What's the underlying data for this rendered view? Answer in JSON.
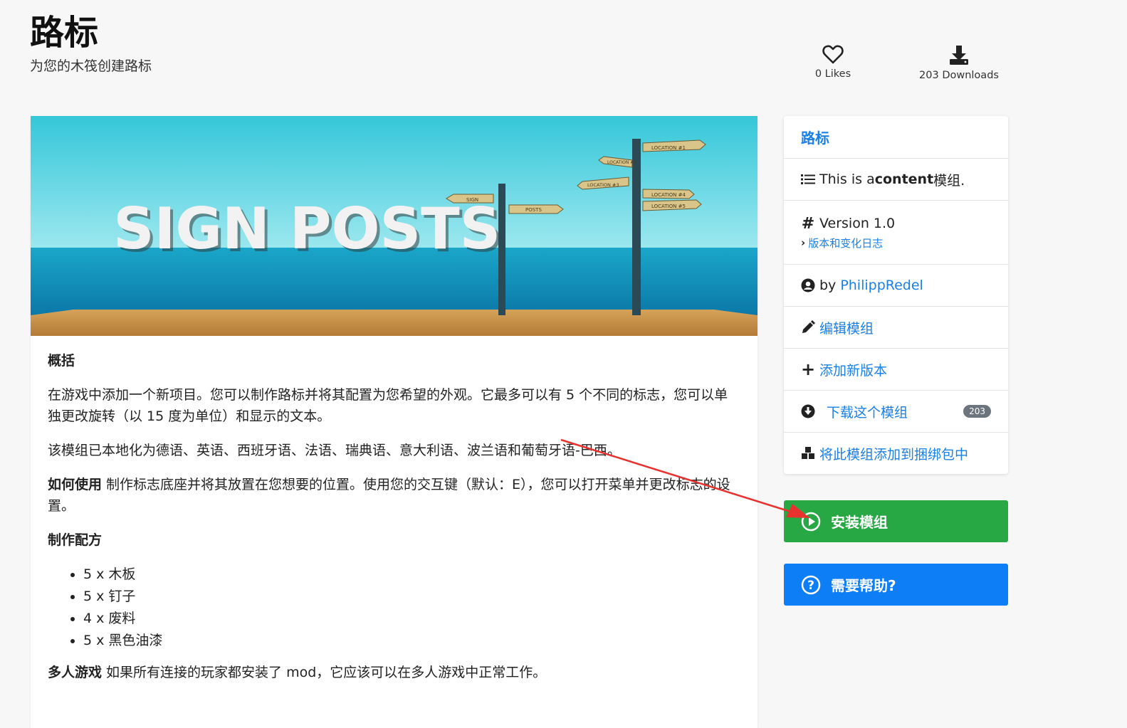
{
  "header": {
    "title": "路标",
    "subtitle": "为您的木筏创建路标",
    "likes": "0 Likes",
    "downloads": "203 Downloads"
  },
  "banner": {
    "title_text": "SIGN POSTS",
    "sign_labels": [
      "SIGN",
      "POSTS",
      "LOCATION #1",
      "LOCATION #2",
      "LOCATION #3",
      "LOCATION #4",
      "LOCATION #5"
    ]
  },
  "content": {
    "overview_heading": "概括",
    "overview_text": "在游戏中添加一个新项目。您可以制作路标并将其配置为您希望的外观。它最多可以有 5 个不同的标志，您可以单独更改旋转（以 15 度为单位）和显示的文本。",
    "localized_text": "该模组已本地化为德语、英语、西班牙语、法语、瑞典语、意大利语、波兰语和葡萄牙语-巴西。",
    "howto_label": "如何使用",
    "howto_text": " 制作标志底座并将其放置在您想要的位置。使用您的交互键（默认：E），您可以打开菜单并更改标志的设置。",
    "recipe_heading": "制作配方",
    "recipe_items": [
      "5 x 木板",
      "5 x 钉子",
      "4 x 废料",
      "5 x 黑色油漆"
    ],
    "multiplayer_label": "多人游戏",
    "multiplayer_text": " 如果所有连接的玩家都安装了 mod，它应该可以在多人游戏中正常工作。"
  },
  "sidebar": {
    "title": "路标",
    "type_prefix": "This is a ",
    "type_bold": "content",
    "type_suffix": " 模组.",
    "version": "Version 1.0",
    "changelog": "版本和变化日志",
    "by_prefix": "by ",
    "author": "PhilippRedel",
    "edit": "编辑模组",
    "add_version": "添加新版本",
    "download": "下载这个模组",
    "download_count": "203",
    "bundle": "将此模组添加到捆绑包中"
  },
  "buttons": {
    "install": "安装模组",
    "help": "需要帮助?"
  },
  "colors": {
    "accent_blue": "#1a7fe6",
    "install_green": "#28a745",
    "help_blue": "#0d7ef5",
    "annotation_arrow": "#e8322d"
  }
}
